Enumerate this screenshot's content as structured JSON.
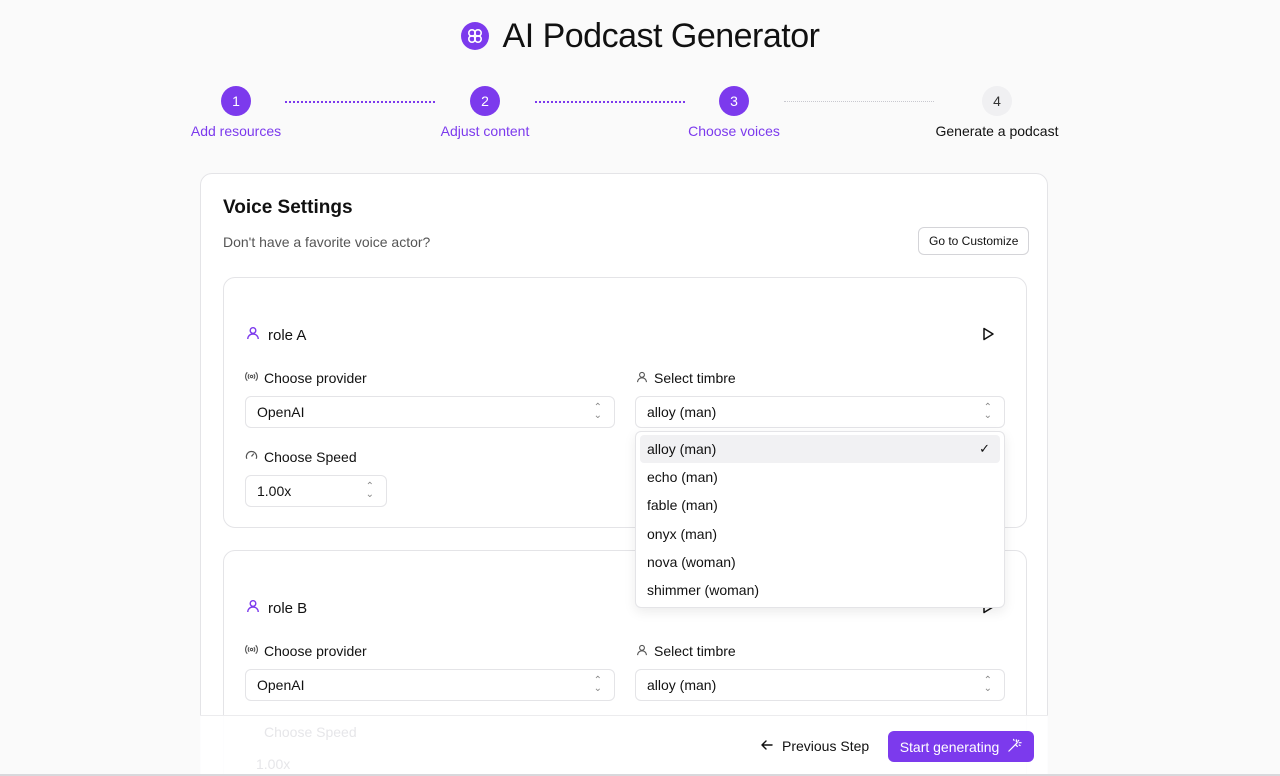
{
  "app": {
    "title": "AI Podcast Generator",
    "accent": "#7c3aed"
  },
  "steps": [
    {
      "number": "1",
      "label": "Add resources",
      "state": "done"
    },
    {
      "number": "2",
      "label": "Adjust content",
      "state": "done"
    },
    {
      "number": "3",
      "label": "Choose voices",
      "state": "current"
    },
    {
      "number": "4",
      "label": "Generate a podcast",
      "state": "todo"
    }
  ],
  "voice_settings": {
    "title": "Voice Settings",
    "subtitle": "Don't have a favorite voice actor?",
    "customize_label": "Go to Customize"
  },
  "roles": [
    {
      "name": "role A",
      "provider_label": "Choose provider",
      "provider_value": "OpenAI",
      "timbre_label": "Select timbre",
      "timbre_value": "alloy (man)",
      "speed_label": "Choose Speed",
      "speed_value": "1.00x"
    },
    {
      "name": "role B",
      "provider_label": "Choose provider",
      "provider_value": "OpenAI",
      "timbre_label": "Select timbre",
      "timbre_value": "alloy (man)",
      "speed_label": "Choose Speed",
      "speed_value": "1.00x"
    }
  ],
  "timbre_options": [
    {
      "label": "alloy (man)",
      "selected": true
    },
    {
      "label": "echo (man)",
      "selected": false
    },
    {
      "label": "fable (man)",
      "selected": false
    },
    {
      "label": "onyx (man)",
      "selected": false
    },
    {
      "label": "nova (woman)",
      "selected": false
    },
    {
      "label": "shimmer (woman)",
      "selected": false
    }
  ],
  "footer": {
    "previous_label": "Previous Step",
    "start_label": "Start generating"
  },
  "icons": {
    "logo": "sparkle-knot-icon",
    "role": "user-icon",
    "play": "play-icon",
    "provider": "broadcast-icon",
    "timbre": "user-icon",
    "speed": "gauge-icon",
    "select": "chevrons-up-down-icon",
    "check": "check-icon",
    "previous": "arrow-left-icon",
    "start": "magic-wand-icon"
  }
}
